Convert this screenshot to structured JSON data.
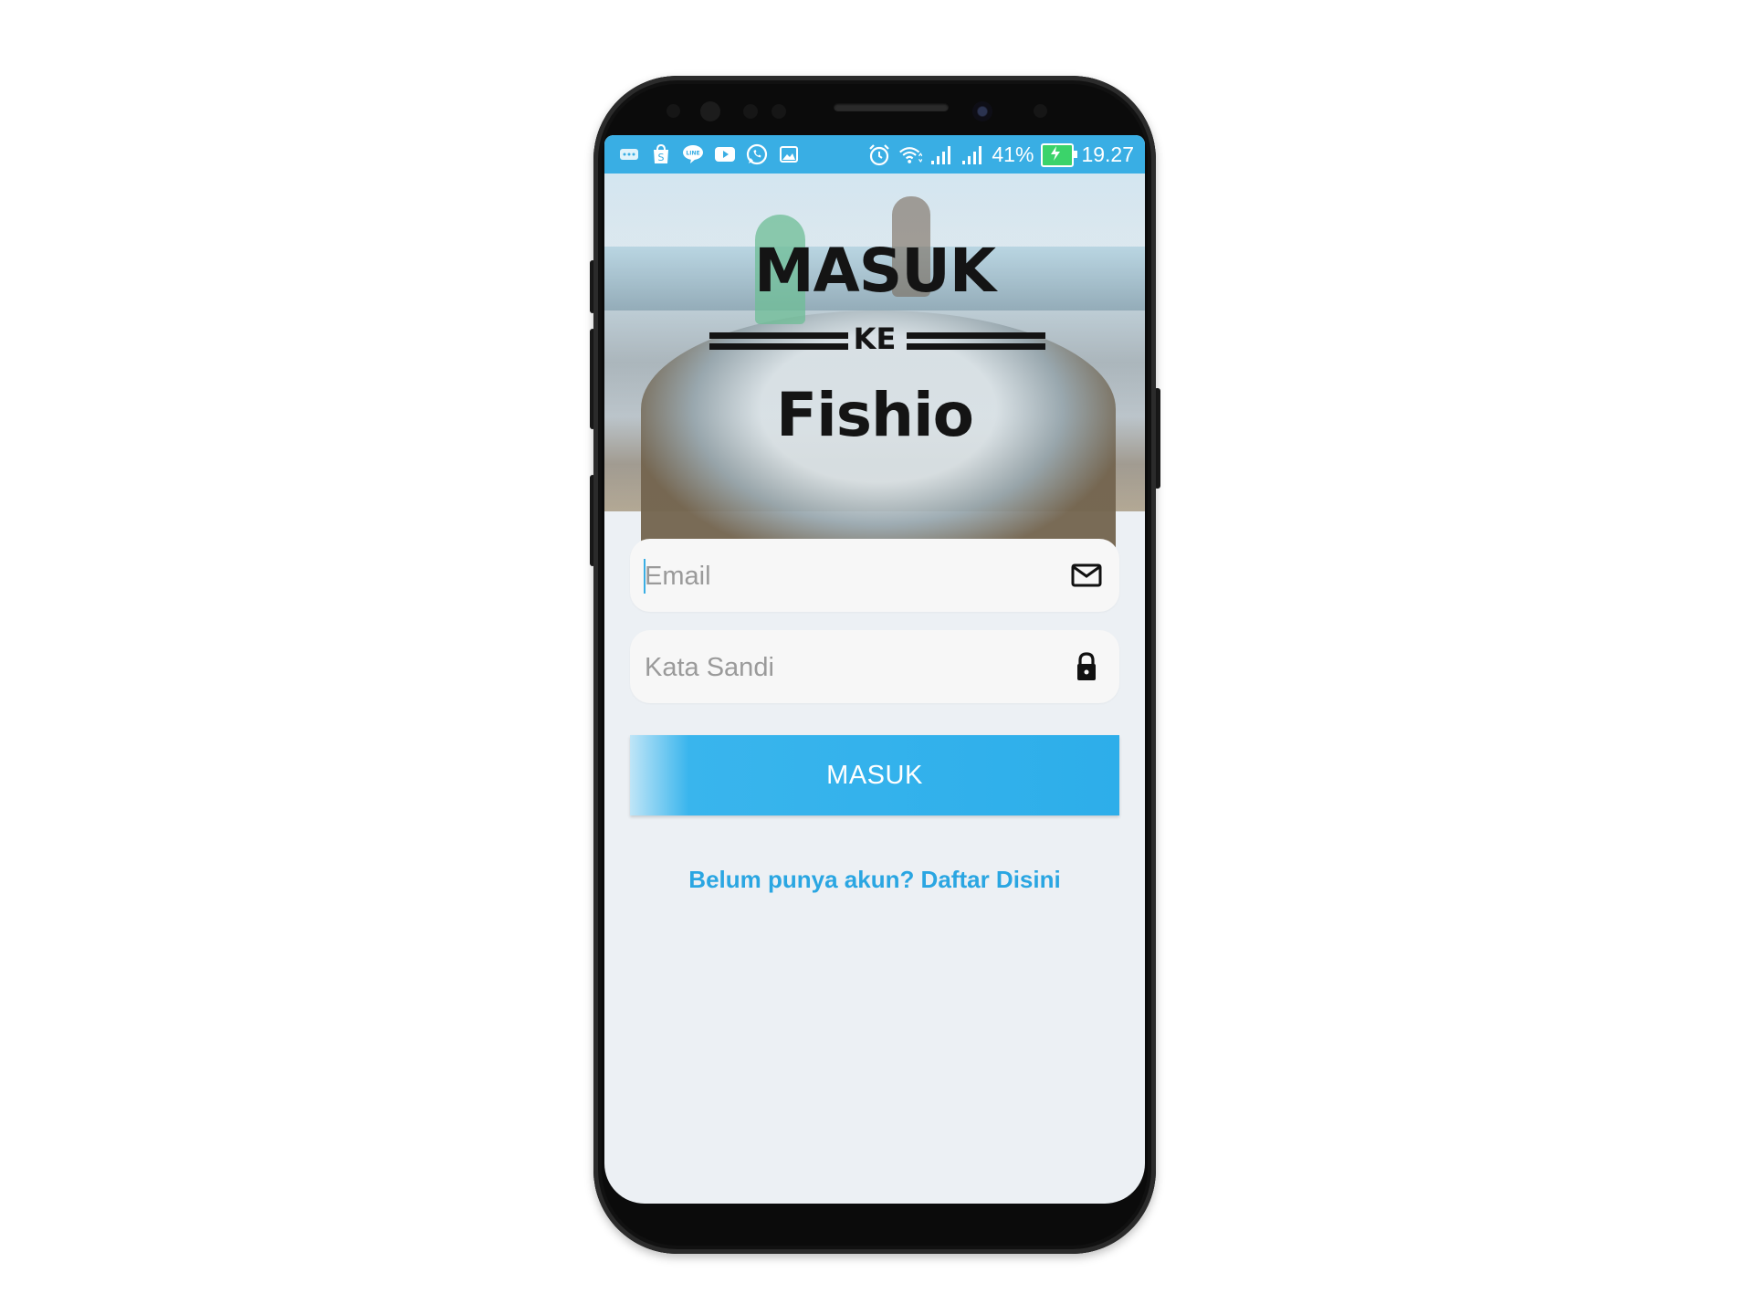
{
  "status_bar": {
    "battery_percent": "41%",
    "time": "19.27",
    "left_icons": [
      "more-icon",
      "shopee-icon",
      "line-icon",
      "youtube-icon",
      "whatsapp-icon",
      "gallery-icon"
    ],
    "right_icons": [
      "alarm-icon",
      "wifi-icon",
      "signal-icon",
      "signal-icon",
      "battery-charging-icon"
    ],
    "background_color": "#39aee4"
  },
  "header": {
    "title_top": "MASUK",
    "title_middle": "KE",
    "title_bottom": "Fishio"
  },
  "form": {
    "email_placeholder": "Email",
    "email_icon": "envelope-icon",
    "password_placeholder": "Kata Sandi",
    "password_icon": "lock-icon",
    "submit_label": "MASUK",
    "submit_color": "#2daeea"
  },
  "register_link": "Belum punya akun? Daftar Disini",
  "colors": {
    "accent": "#2aa6e2",
    "screen_background": "#ecf0f4"
  }
}
